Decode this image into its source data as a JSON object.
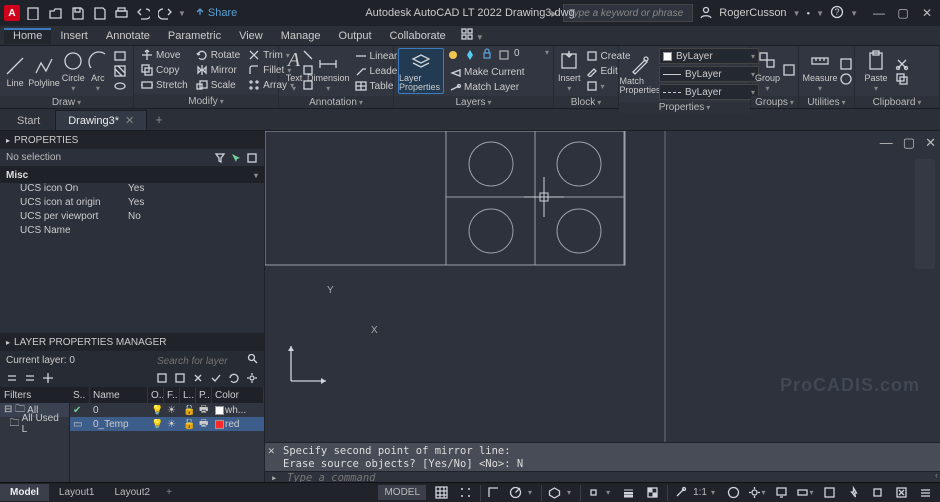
{
  "app": {
    "logo_letter": "A",
    "title": "Autodesk AutoCAD LT 2022    Drawing3.dwg",
    "share_label": "Share",
    "search_placeholder": "Type a keyword or phrase",
    "user_name": "RogerCusson"
  },
  "menu": {
    "items": [
      "Home",
      "Insert",
      "Annotate",
      "Parametric",
      "View",
      "Manage",
      "Output",
      "Collaborate"
    ],
    "active": 0
  },
  "ribbon": {
    "draw": {
      "label": "Draw",
      "line": "Line",
      "polyline": "Polyline",
      "circle": "Circle",
      "arc": "Arc"
    },
    "modify": {
      "label": "Modify",
      "row1": [
        "Move",
        "Rotate",
        "Trim"
      ],
      "row2": [
        "Copy",
        "Mirror",
        "Fillet"
      ],
      "row3": [
        "Stretch",
        "Scale",
        "Array"
      ]
    },
    "annotation": {
      "label": "Annotation",
      "text": "Text",
      "dimension": "Dimension",
      "row1": "Linear",
      "row2": "Leader",
      "row3": "Table"
    },
    "layers": {
      "label": "Layers",
      "layer_props": "Layer\nProperties",
      "mc": "Make Current",
      "ml": "Match Layer"
    },
    "block": {
      "label": "Block",
      "insert": "Insert",
      "create": "Create",
      "edit": "Edit"
    },
    "properties": {
      "label": "Properties",
      "match": "Match\nProperties",
      "bylayer": "ByLayer"
    },
    "groups": {
      "label": "Groups",
      "group": "Group"
    },
    "utilities": {
      "label": "Utilities",
      "measure": "Measure"
    },
    "clipboard": {
      "label": "Clipboard",
      "paste": "Paste"
    }
  },
  "file_tabs": {
    "tabs": [
      {
        "label": "Start",
        "active": false
      },
      {
        "label": "Drawing3*",
        "active": true
      }
    ],
    "add": "+"
  },
  "properties": {
    "title": "PROPERTIES",
    "selection": "No selection",
    "section": "Misc",
    "rows": [
      {
        "k": "UCS icon On",
        "v": "Yes"
      },
      {
        "k": "UCS icon at origin",
        "v": "Yes"
      },
      {
        "k": "UCS per viewport",
        "v": "No"
      },
      {
        "k": "UCS Name",
        "v": ""
      }
    ]
  },
  "layers": {
    "title": "LAYER PROPERTIES MANAGER",
    "current": "Current layer: 0",
    "search_placeholder": "Search for layer",
    "filters_head": "Filters",
    "filters": [
      {
        "label": "All",
        "sel": true
      },
      {
        "label": "All Used L",
        "sel": false
      }
    ],
    "cols": [
      "S..",
      "Name",
      "O..",
      "F..",
      "L..",
      "P..",
      "Color"
    ],
    "rows": [
      {
        "name": "0",
        "color": "#ffffff",
        "color_name": "wh...",
        "sel": false
      },
      {
        "name": "0_Temp",
        "color": "#ff2a2a",
        "color_name": "red",
        "sel": true
      }
    ]
  },
  "viewport": {
    "ucs_x": "X",
    "ucs_y": "Y",
    "watermark": "ProCADIS.com"
  },
  "command": {
    "line1": "Specify second point of mirror line:",
    "line2": "Erase source objects? [Yes/No] <No>: N",
    "placeholder": "Type a command"
  },
  "layout_tabs": {
    "tabs": [
      "Model",
      "Layout1",
      "Layout2"
    ],
    "active": 0,
    "add": "+"
  },
  "status": {
    "model": "MODEL",
    "scale": "1:1"
  }
}
